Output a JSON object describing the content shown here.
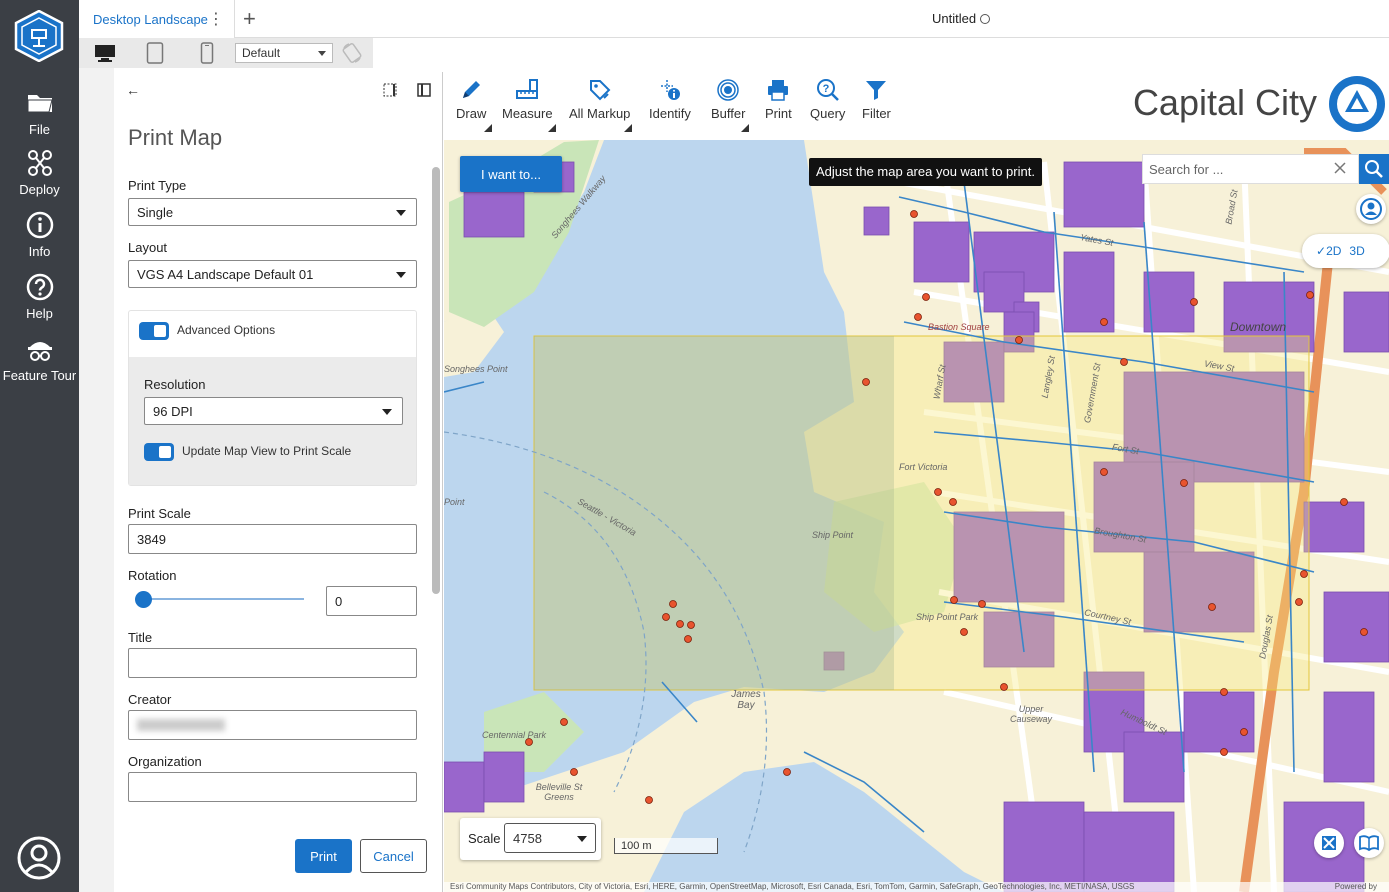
{
  "app": {
    "nav": [
      {
        "label": "File",
        "icon": "folder-icon"
      },
      {
        "label": "Deploy",
        "icon": "deploy-icon"
      },
      {
        "label": "Info",
        "icon": "info-icon"
      },
      {
        "label": "Help",
        "icon": "help-icon"
      },
      {
        "label": "Feature Tour",
        "icon": "feature-tour-icon"
      }
    ]
  },
  "tabs": {
    "active_label": "Desktop Landscape",
    "add_label": "+",
    "more_label": "⋮"
  },
  "document": {
    "title": "Untitled"
  },
  "device_bar": {
    "preset_value": "Default"
  },
  "panel": {
    "back_label": "←",
    "title": "Print Map",
    "print_type_label": "Print Type",
    "print_type_value": "Single",
    "layout_label": "Layout",
    "layout_value": "VGS A4 Landscape Default 01",
    "advanced_label": "Advanced Options",
    "resolution_label": "Resolution",
    "resolution_value": "96 DPI",
    "update_view_label": "Update Map View to Print Scale",
    "print_scale_label": "Print Scale",
    "print_scale_value": "3849",
    "rotation_label": "Rotation",
    "rotation_value": "0",
    "title_label": "Title",
    "title_value": "",
    "creator_label": "Creator",
    "organization_label": "Organization",
    "organization_value": "",
    "print_button": "Print",
    "cancel_button": "Cancel"
  },
  "toolbar": {
    "tools": [
      {
        "label": "Draw",
        "icon": "pencil-icon"
      },
      {
        "label": "Measure",
        "icon": "ruler-icon"
      },
      {
        "label": "All Markup",
        "icon": "tag-icon"
      },
      {
        "label": "Identify",
        "icon": "identify-icon"
      },
      {
        "label": "Buffer",
        "icon": "buffer-icon"
      },
      {
        "label": "Print",
        "icon": "printer-icon"
      },
      {
        "label": "Query",
        "icon": "query-icon"
      },
      {
        "label": "Filter",
        "icon": "filter-icon"
      }
    ]
  },
  "map": {
    "brand_title": "Capital City",
    "i_want_to": "I want to...",
    "tooltip": "Adjust the map area you want to print.",
    "search_placeholder": "Search for ...",
    "view_2d": "2D",
    "view_3d": "3D",
    "scale_label": "Scale",
    "scale_value": "4758",
    "scale_bar_label": "100 m",
    "labels": {
      "songhees_walkway": "Songhees Walkway",
      "songhees_point": "Songhees Point",
      "bastion_square": "Bastion Square",
      "downtown": "Downtown",
      "yates_st": "Yates St",
      "view_st": "View St",
      "fort_st": "Fort St",
      "fort_victoria": "Fort Victoria",
      "ship_point": "Ship Point",
      "ship_point_park": "Ship Point Park",
      "broughton_st": "Broughton St",
      "courtney_st": "Courtney St",
      "douglas_st": "Douglas St",
      "james_bay": "James Bay",
      "centennial_park": "Centennial Park",
      "upper_causeway": "Upper Causeway",
      "humboldt_st": "Humboldt St",
      "wharf_st": "Wharf St",
      "government_st": "Government St",
      "langley_st": "Langley St",
      "broad_st": "Broad St",
      "seattle_victoria": "Seattle - Victoria",
      "point": "Point",
      "belleville_st_greens": "Belleville St Greens"
    },
    "attribution": "Esri Community Maps Contributors, City of Victoria, Esri, HERE, Garmin, OpenStreetMap, Microsoft, Esri Canada, Esri, TomTom, Garmin, SafeGraph, GeoTechnologies, Inc, METI/NASA, USGS",
    "powered_by": "Powered by"
  },
  "colors": {
    "accent": "#1a73c8",
    "appbar": "#3b3f45",
    "building": "#9966cc",
    "water": "#bcd6ee",
    "land": "#f7f1d8",
    "print_area": "#f5e97a"
  }
}
